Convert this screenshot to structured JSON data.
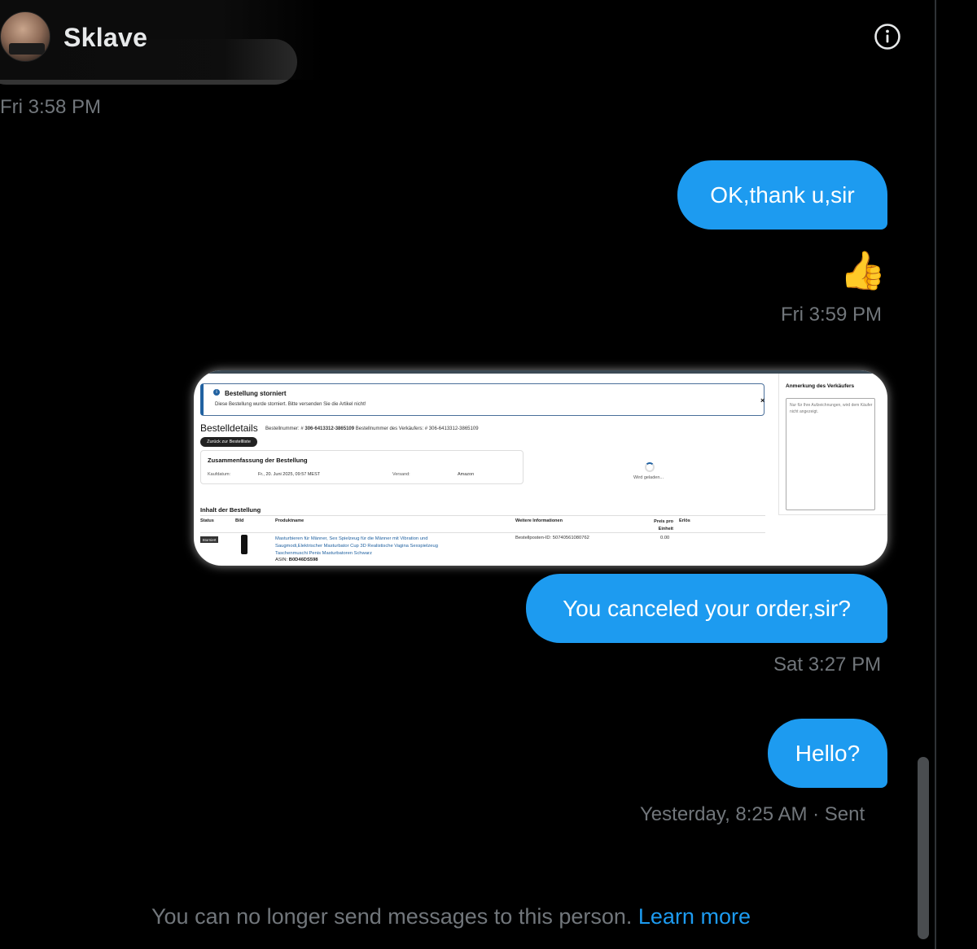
{
  "header": {
    "name": "Sklave",
    "info_icon": "info-circle-icon"
  },
  "messages": {
    "ts1": "Fri 3:58 PM",
    "bubble1": "OK,thank u,sir",
    "emoji": "👍",
    "ts2": "Fri 3:59 PM",
    "bubble2": "You canceled your order,sir?",
    "ts3": "Sat 3:27 PM",
    "bubble3": "Hello?",
    "ts4": "Yesterday, 8:25 AM · Sent"
  },
  "attachment": {
    "alert_title": "Bestellung storniert",
    "alert_text": "Diese Bestellung wurde storniert. Bitte versenden Sie die Artikel nicht!",
    "alert_close": "×",
    "title": "Bestelldetails",
    "order_label": "Bestellnummer: # ",
    "order_number": "306-6413312-3865109",
    "seller_order_label": "   Bestellnummer des Verkäufers: # 306-6413312-3865109",
    "back_button": "Zurück zur Bestellliste",
    "summary_title": "Zusammenfassung der Bestellung",
    "purchase_date_label": "Kaufdatum:",
    "purchase_date": "Fr., 20. Juni 2025, 09:57 MEST",
    "shipping_label": "Versand:",
    "shipping_value": "Amazon",
    "loading": "Wird geladen...",
    "notes_title": "Anmerkung des Verkäufers",
    "notes_placeholder": "Nur für Ihre Aufzeichnungen, wird dem Käufer nicht angezeigt.",
    "contents_title": "Inhalt der Bestellung",
    "columns": [
      "Status",
      "Bild",
      "Produktname",
      "Weitere Informationen",
      "Preis pro Einheit",
      "Erlös"
    ],
    "status": "Storniert",
    "product_name": "Masturbieren für Männer, Sex Spielzeug für die Männer mit Vibration und Saugmodi,Elektrischer Masturbator Cup 3D Realistische Vagina Sexspielzeug Taschenmuschi Penis Masturbatoren Schwarz",
    "asin_label": "ASIN: ",
    "asin": "B0D46DS598",
    "item_id": "Bestellposten-ID: 50740561080762",
    "unit_price": "0.00"
  },
  "footer": {
    "text": "You can no longer send messages to this person. ",
    "link": "Learn more"
  },
  "colors": {
    "bubble": "#1d9bf0",
    "background": "#000000",
    "muted_text": "#71767b"
  }
}
